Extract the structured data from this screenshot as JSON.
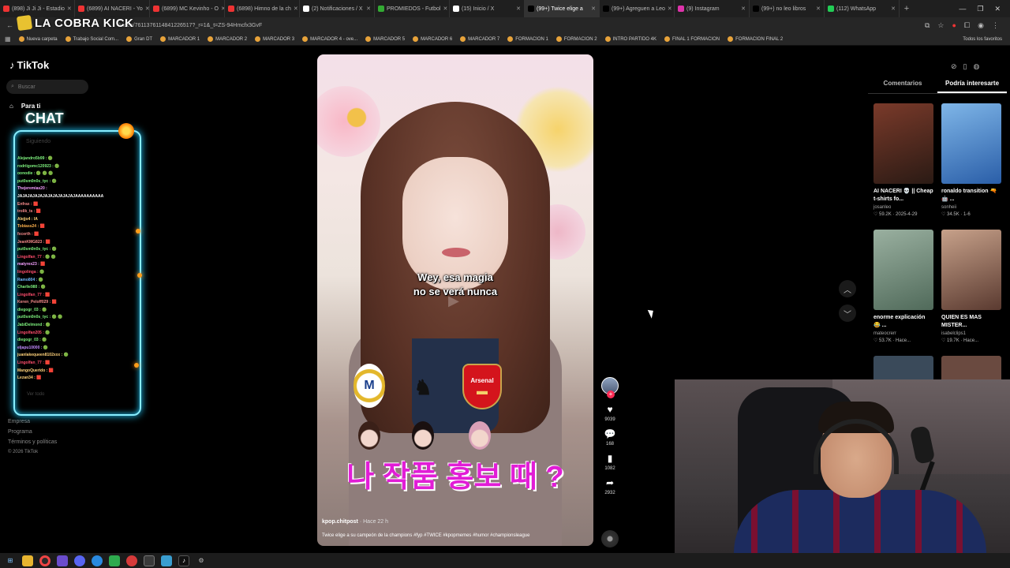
{
  "browser": {
    "tabs": [
      {
        "label": "(898) Ji Ji Ji - Estadio",
        "color": "#e33"
      },
      {
        "label": "(6899) AI NACERI - Yo",
        "color": "#e33"
      },
      {
        "label": "(6899) MC Kevinho - O",
        "color": "#e33"
      },
      {
        "label": "(6898) Himno de la ch",
        "color": "#e33"
      },
      {
        "label": "(2) Notificaciones / X",
        "color": "#fff"
      },
      {
        "label": "PROMIEDOS - Futbol",
        "color": "#3a3"
      },
      {
        "label": "(15) Inicio / X",
        "color": "#fff"
      },
      {
        "label": "(99+) Twice elige a",
        "color": "#000",
        "active": true
      },
      {
        "label": "(99+) Agreguen a Leo",
        "color": "#000"
      },
      {
        "label": "(9) Instagram",
        "color": "#d3a"
      },
      {
        "label": "(99+) no leo libros",
        "color": "#000"
      },
      {
        "label": "(112) WhatsApp",
        "color": "#2c5"
      }
    ],
    "url": "/video/7611376114841226517?_r=1&_t=ZS-94Hmcfx3GvF",
    "bookmarks": [
      "Nueva carpeta",
      "Trabajo Social Com...",
      "Gran DT",
      "MARCADOR 1",
      "MARCADOR 2",
      "MARCADOR 3",
      "MARCADOR 4 - ove...",
      "MARCADOR 5",
      "MARCADOR 6",
      "MARCADOR 7",
      "FORMACION 1",
      "FORMACION 2",
      "INTRO PARTIDO 4K",
      "FINAL 1 FORMACION",
      "FORMACION FINAL 2"
    ],
    "all_bookmarks": "Todos los favoritos"
  },
  "overlay": {
    "brand": "LA COBRA KICK",
    "chat_title": "CHAT",
    "chat_lines": [
      {
        "text": "Alejandro5b99 : 🟢",
        "color": "#7ef27e"
      },
      {
        "text": "rodriigomc120923 : 🟢",
        "color": "#7ef27e"
      },
      {
        "text": "oonodie : 🟢 🟢 🟢",
        "color": "#7ef27e"
      },
      {
        "text": "put0sm0n0s_tyc : 🟢",
        "color": "#7ef27e"
      },
      {
        "text": "Thejeremias20 :",
        "color": "#f5a0ff"
      },
      {
        "text": "JAJAJAJAJAJAJAJAJAJAJAJAAAAAAAAAA",
        "color": "#ffffff"
      },
      {
        "text": "Enfrax : 🟥",
        "color": "#f78b8b"
      },
      {
        "text": "trolik_ts : 🟥",
        "color": "#f78b8b"
      },
      {
        "text": "Alejjo4 : IA",
        "color": "#ffd27a"
      },
      {
        "text": "Tobiass24 : 🟥",
        "color": "#ffb24d"
      },
      {
        "text": "fxcerth : 🟥",
        "color": "#f78b8b"
      },
      {
        "text": "JeanKMG823 : 🟥",
        "color": "#f78b8b"
      },
      {
        "text": "put0sm0n0s_tyc : 🟢",
        "color": "#7ef27e"
      },
      {
        "text": "Lingolfan_77 : 🟢 🟢",
        "color": "#ff4d6d"
      },
      {
        "text": "matyrex23 : 🟥",
        "color": "#f5a0ff"
      },
      {
        "text": "lingolinga : 🟢",
        "color": "#ff4d6d"
      },
      {
        "text": "Ramo804 : 🟢",
        "color": "#6fb8ff"
      },
      {
        "text": "Charlie980 : 🟢",
        "color": "#7ef27e"
      },
      {
        "text": "Lingolfan_77 : 🟥",
        "color": "#ff4d6d"
      },
      {
        "text": "Keren_Peloff029 : 🟥",
        "color": "#f78b8b"
      },
      {
        "text": "diegogr_03 : 🟢",
        "color": "#7ef27e"
      },
      {
        "text": "put0sm0n0s_tyc : 🟢 🟢",
        "color": "#7ef27e"
      },
      {
        "text": "JabiDelmond : 🟢",
        "color": "#7ef27e"
      },
      {
        "text": "Lingolfan205 : 🟢",
        "color": "#ff4d6d"
      },
      {
        "text": "diegogr_03 : 🟢",
        "color": "#7ef27e"
      },
      {
        "text": "eljapu10000 : 🟢",
        "color": "#c38cff"
      },
      {
        "text": "juanlakequeen8102xxx : 🟢",
        "color": "#ffd27a"
      },
      {
        "text": "Lingolfan_77 : 🟥",
        "color": "#ff4d6d"
      },
      {
        "text": "MangoQuerido : 🟥",
        "color": "#ffd27a"
      },
      {
        "text": "Lezan34 : 🟥",
        "color": "#ffd27a"
      }
    ],
    "faded_siguiendo": "Siguiendo",
    "faded_ver_todo": "Ver todo"
  },
  "tiktok": {
    "logo": "TikTok",
    "search_placeholder": "Buscar",
    "nav_para_ti": "Para ti",
    "footer": [
      "Empresa",
      "Programa",
      "Términos y políticas"
    ],
    "copyright": "© 2026 TikTok"
  },
  "video": {
    "subtitle_line1": "Wey, esa magia",
    "subtitle_line2": "no se verá nunca",
    "crest_arsenal": "Arsenal",
    "korean_text": "나 작품 홍보 때 ?",
    "author": "kpop.chitpost",
    "time": "· Hace 22 h",
    "caption": "Twice elige a su campeón de la champions #fyp #TWICE #kpopmemes #humor #championsleague",
    "likes": "9039",
    "comments": "168",
    "saves": "1082",
    "shares": "2932"
  },
  "right_panel": {
    "tab_comments": "Comentarios",
    "tab_interest": "Podría interesarte",
    "cards": [
      {
        "title": "AI NACERI 💀 || Cheap t-shirts fo...",
        "author": "josanleo",
        "meta": "♡ 59.2K · 2025-4-29",
        "bg1": "#7a3a2a",
        "bg2": "#2a1a14"
      },
      {
        "title": "ronaldo transition 🔫 🤖 ...",
        "author": "sonheii",
        "meta": "♡ 34.5K · 1-6",
        "bg1": "#7fb6e8",
        "bg2": "#2a5ea8"
      },
      {
        "title": "enorme explicación 😂 ...",
        "author": "mateocrerr",
        "meta": "♡ 53.7K · Hace...",
        "bg1": "#9ab0a0",
        "bg2": "#506a5a"
      },
      {
        "title": "QUIEN ES MAS MISTER...",
        "author": "isabelclips1",
        "meta": "♡ 19.7K · Hace...",
        "bg1": "#c7a18a",
        "bg2": "#5a3a30"
      }
    ]
  }
}
